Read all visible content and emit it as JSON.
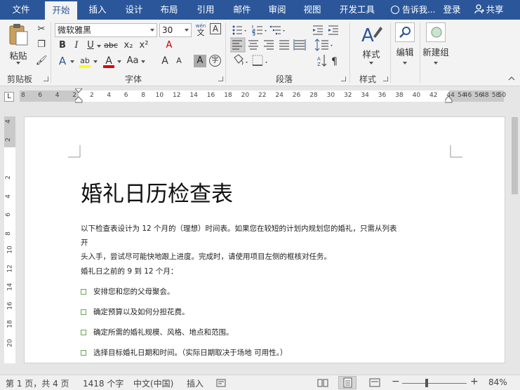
{
  "tabs": [
    "文件",
    "开始",
    "插入",
    "设计",
    "布局",
    "引用",
    "邮件",
    "审阅",
    "视图",
    "开发工具"
  ],
  "tell_me": "告诉我...",
  "login": "登录",
  "share": "共享",
  "ribbon": {
    "clipboard": {
      "paste_label": "粘贴",
      "group_label": "剪贴板"
    },
    "font": {
      "font_name": "微软雅黑",
      "font_size": "30",
      "wen_label": "wén",
      "wen_char": "文",
      "a_box": "A",
      "bold": "B",
      "italic": "I",
      "underline": "U",
      "strike": "abc",
      "subscript": "x₂",
      "superscript": "x²",
      "clear_format": "A",
      "text_effect": "A",
      "highlight": "ab",
      "font_color": "A",
      "aa_case": "Aa",
      "grow": "A",
      "shrink": "A",
      "char_shading": "A",
      "enclose": "字",
      "group_label": "字体"
    },
    "paragraph": {
      "group_label": "段落"
    },
    "styles": {
      "style_label": "样式",
      "group_label": "样式"
    },
    "edit_label": "编辑",
    "new_group_label": "新建组"
  },
  "ruler": {
    "h_left": [
      "8",
      "6",
      "4",
      "2"
    ],
    "h_main": [
      "2",
      "4",
      "6",
      "8",
      "10",
      "12",
      "14",
      "16",
      "18",
      "20",
      "22",
      "24",
      "26",
      "28",
      "30",
      "32",
      "34",
      "36",
      "38",
      "40",
      "42",
      "44",
      "46",
      "48",
      "50"
    ],
    "h_right": [
      "54",
      "56",
      "58"
    ],
    "v_top": [
      "4",
      "2"
    ],
    "v_main": [
      "2",
      "4",
      "6",
      "8",
      "10",
      "12",
      "14",
      "16",
      "18",
      "20"
    ],
    "tab_selector": "L"
  },
  "document": {
    "title": "婚礼日历检查表",
    "intro_line1": "以下检查表设计为 12 个月的（理想）时间表。如果您在较短的计划内规划您的婚礼，只需从列表开",
    "intro_line2": "头入手，尝试尽可能快地跟上进度。完成时，请使用项目左侧的框核对任务。",
    "subheading": "婚礼日之前的 9 到 12 个月：",
    "checklist": [
      "安排您和您的父母聚会。",
      "确定预算以及如何分担花费。",
      "确定所需的婚礼规模、风格、地点和范围。",
      "选择目标婚礼日期和时间。（实际日期取决于场地 可用性。）"
    ]
  },
  "status": {
    "page": "第 1 页，共 4 页",
    "words": "1418 个字",
    "language": "中文(中国)",
    "mode": "插入",
    "zoom": "84%",
    "zoom_minus": "−",
    "zoom_plus": "+"
  },
  "colors": {
    "accent": "#2b579a",
    "checkbox": "#6aa84f",
    "highlight_yellow": "#ffff00",
    "font_red": "#e00000"
  }
}
